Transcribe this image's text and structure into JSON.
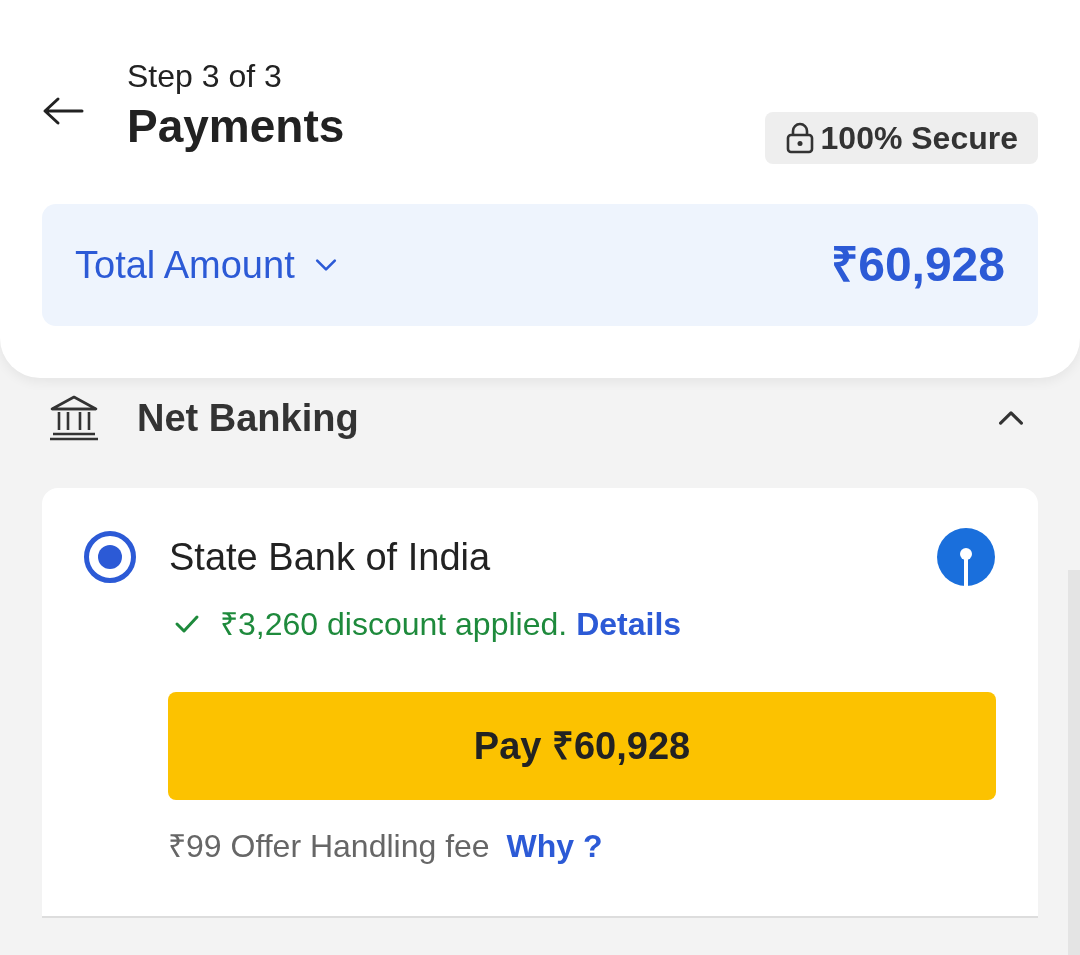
{
  "header": {
    "step": "Step 3 of 3",
    "title": "Payments",
    "secure_badge": "100% Secure"
  },
  "total": {
    "label": "Total Amount",
    "amount": "₹60,928",
    "expanded": false
  },
  "section": {
    "title": "Net Banking",
    "expanded": true
  },
  "banks": [
    {
      "name": "State Bank of India",
      "selected": true,
      "discount": "₹3,260 discount applied.",
      "details_link": "Details",
      "pay_button": "Pay ₹60,928",
      "fee": "₹99 Offer Handling fee",
      "fee_link": "Why ?"
    }
  ]
}
